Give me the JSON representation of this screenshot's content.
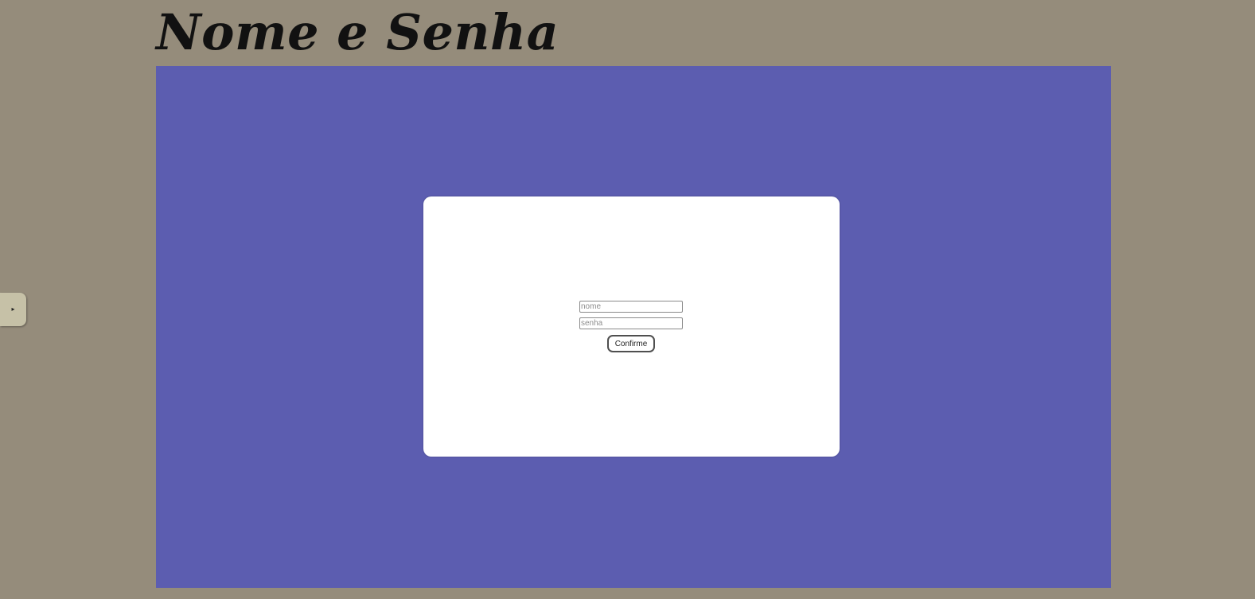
{
  "page": {
    "title": "Nome e Senha"
  },
  "side_toggle": {
    "icon": "triangle-right",
    "glyph": "▸"
  },
  "form": {
    "name_placeholder": "nome",
    "name_value": "",
    "password_placeholder": "senha",
    "password_value": "",
    "submit_label": "Confirme"
  },
  "colors": {
    "page_background": "#958c7b",
    "stage_background": "#5c5db0",
    "card_background": "#ffffff",
    "toggle_background": "#c6c1a7"
  }
}
